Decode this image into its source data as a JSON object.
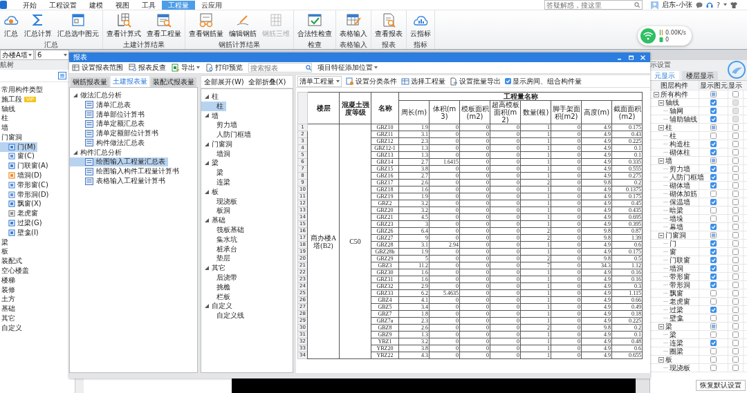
{
  "menu_bar": {
    "tabs": [
      {
        "label": "开始",
        "selected": false
      },
      {
        "label": "工程设置",
        "selected": false
      },
      {
        "label": "建模",
        "selected": false
      },
      {
        "label": "视图",
        "selected": false
      },
      {
        "label": "工具",
        "selected": false
      },
      {
        "label": "工程量",
        "selected": true
      },
      {
        "label": "云应用",
        "selected": false
      }
    ],
    "search": {
      "placeholder": "答疑解惑，搜这里"
    },
    "user": "启东-小张",
    "help": "?"
  },
  "ribbon": {
    "groups": [
      {
        "label": "汇总",
        "buttons": [
          {
            "label": "汇总",
            "disabled": false
          },
          {
            "label": "汇总计算",
            "disabled": false
          },
          {
            "label": "汇总选中图元",
            "disabled": false
          }
        ]
      },
      {
        "label": "土建计算结果",
        "buttons": [
          {
            "label": "查看计算式",
            "disabled": false
          },
          {
            "label": "查看工程量",
            "disabled": false
          }
        ]
      },
      {
        "label": "钢筋计算结果",
        "buttons": [
          {
            "label": "查看钢筋量",
            "disabled": false
          },
          {
            "label": "编辑钢筋",
            "disabled": false
          },
          {
            "label": "钢筋三维",
            "disabled": true
          }
        ]
      },
      {
        "label": "检查",
        "buttons": [
          {
            "label": "合法性检查",
            "disabled": false
          }
        ]
      },
      {
        "label": "表格输入",
        "buttons": [
          {
            "label": "表格输入",
            "disabled": false
          }
        ]
      },
      {
        "label": "报表",
        "buttons": [
          {
            "label": "查看报表",
            "disabled": false
          }
        ]
      },
      {
        "label": "指标",
        "buttons": [
          {
            "label": "云指标",
            "disabled": false
          }
        ]
      }
    ]
  },
  "network": {
    "speed": "0.00K/s",
    "count": "0"
  },
  "selectors": [
    {
      "value": "办楼A塔"
    },
    {
      "value": "6"
    }
  ],
  "nav_panel": {
    "title": "航树",
    "items": [
      {
        "label": "常用构件类型",
        "selected": false
      },
      {
        "label": "施工段",
        "selected": false,
        "badge": "VIP"
      },
      {
        "label": "轴线",
        "selected": false
      },
      {
        "label": "柱",
        "selected": false
      },
      {
        "label": "墙",
        "selected": false
      },
      {
        "label": "门窗洞",
        "selected": false,
        "children": [
          {
            "label": "门(M)",
            "selected": true
          },
          {
            "label": "窗(C)",
            "selected": false
          },
          {
            "label": "门联窗(A)",
            "selected": false
          },
          {
            "label": "墙洞(D)",
            "selected": false
          },
          {
            "label": "带形窗(C)",
            "selected": false
          },
          {
            "label": "带形洞(D)",
            "selected": false
          },
          {
            "label": "飘窗(X)",
            "selected": false
          },
          {
            "label": "老虎窗",
            "selected": false
          },
          {
            "label": "过梁(G)",
            "selected": false
          },
          {
            "label": "壁龛(I)",
            "selected": false
          }
        ]
      },
      {
        "label": "梁",
        "selected": false
      },
      {
        "label": "板",
        "selected": false
      },
      {
        "label": "装配式",
        "selected": false
      },
      {
        "label": "空心楼盖",
        "selected": false
      },
      {
        "label": "楼梯",
        "selected": false
      },
      {
        "label": "装修",
        "selected": false
      },
      {
        "label": "土方",
        "selected": false
      },
      {
        "label": "基础",
        "selected": false
      },
      {
        "label": "其它",
        "selected": false
      },
      {
        "label": "自定义",
        "selected": false
      }
    ]
  },
  "report_window": {
    "title": "报表",
    "toolbar": [
      {
        "label": "设置报表范围",
        "dropdown": false
      },
      {
        "label": "报表反查",
        "dropdown": false
      },
      {
        "label": "导出",
        "dropdown": true
      },
      {
        "label": "打印预览",
        "dropdown": false
      }
    ],
    "search": {
      "placeholder": "搜索报表"
    },
    "position_menu": {
      "label": "项目特征添加位置"
    },
    "tabs": [
      {
        "label": "钢筋报表量",
        "selected": false
      },
      {
        "label": "土建报表量",
        "selected": true
      },
      {
        "label": "装配式报表量",
        "selected": false
      }
    ],
    "report_tree": [
      {
        "label": "做法汇总分析",
        "expanded": true,
        "selected": false,
        "children": [
          {
            "label": "清单汇总表",
            "selected": false
          },
          {
            "label": "清单部位计算书",
            "selected": false
          },
          {
            "label": "清单定额汇总表",
            "selected": false
          },
          {
            "label": "清单定额部位计算书",
            "selected": false
          },
          {
            "label": "构件做法汇总表",
            "selected": false
          }
        ]
      },
      {
        "label": "构件汇总分析",
        "expanded": true,
        "selected": false,
        "children": [
          {
            "label": "绘图输入工程量汇总表",
            "selected": true
          },
          {
            "label": "绘图输入构件工程量计算书",
            "selected": false
          },
          {
            "label": "表格输入工程量计算书",
            "selected": false
          }
        ]
      }
    ],
    "expand_all": "全部展开(W)",
    "collapse_all": "全部折叠(X)",
    "component_tree": [
      {
        "label": "柱",
        "expanded": true,
        "selected": false,
        "children": [
          {
            "label": "柱",
            "selected": true
          }
        ]
      },
      {
        "label": "墙",
        "expanded": true,
        "selected": false,
        "children": [
          {
            "label": "剪力墙",
            "selected": false
          },
          {
            "label": "人防门框墙",
            "selected": false
          }
        ]
      },
      {
        "label": "门窗洞",
        "expanded": true,
        "selected": false,
        "children": [
          {
            "label": "墙洞",
            "selected": false
          }
        ]
      },
      {
        "label": "梁",
        "expanded": true,
        "selected": false,
        "children": [
          {
            "label": "梁",
            "selected": false
          },
          {
            "label": "连梁",
            "selected": false
          }
        ]
      },
      {
        "label": "板",
        "expanded": true,
        "selected": false,
        "children": [
          {
            "label": "现浇板",
            "selected": false
          },
          {
            "label": "板洞",
            "selected": false
          }
        ]
      },
      {
        "label": "基础",
        "expanded": true,
        "selected": false,
        "children": [
          {
            "label": "筏板基础",
            "selected": false
          },
          {
            "label": "集水坑",
            "selected": false
          },
          {
            "label": "桩承台",
            "selected": false
          },
          {
            "label": "垫层",
            "selected": false
          }
        ]
      },
      {
        "label": "其它",
        "expanded": true,
        "selected": false,
        "children": [
          {
            "label": "后浇带",
            "selected": false
          },
          {
            "label": "挑檐",
            "selected": false
          },
          {
            "label": "栏板",
            "selected": false
          }
        ]
      },
      {
        "label": "自定义",
        "expanded": true,
        "selected": false,
        "children": [
          {
            "label": "自定义线",
            "selected": false
          }
        ]
      }
    ],
    "quantity_type": "清单工程量",
    "table_toolbar": [
      "设置分类条件",
      "选择工程量",
      "设置批量导出"
    ],
    "show_rooms": {
      "label": "显示房间、组合构件量",
      "checked": true
    },
    "table": {
      "columns": {
        "floor": "楼层",
        "grade": "混凝土强度等级",
        "name": "名称",
        "group": "工程量名称",
        "quantities": [
          "周长(m)",
          "体积(m3)",
          "模板面积(m2)",
          "超高模板面积(m2)",
          "数量(根)",
          "脚手架面积(m2)",
          "高度(m)",
          "截面面积(m2)"
        ]
      },
      "floor": "商办楼A塔(B2)",
      "grade": "C50",
      "rows": [
        {
          "no": "1",
          "name": "GBZ10",
          "values": [
            "1.9",
            "0",
            "0",
            "0",
            "1",
            "0",
            "4.9",
            "0.175"
          ]
        },
        {
          "no": "2",
          "name": "GBZ11",
          "values": [
            "3.1",
            "0",
            "0",
            "0",
            "1",
            "0",
            "4.9",
            "0.43"
          ]
        },
        {
          "no": "3",
          "name": "GBZ12",
          "values": [
            "2.3",
            "0",
            "0",
            "0",
            "1",
            "0",
            "4.9",
            "0.225"
          ]
        },
        {
          "no": "4",
          "name": "GBZ12-1",
          "values": [
            "1.3",
            "0",
            "0",
            "0",
            "1",
            "0",
            "4.9",
            "0.1"
          ]
        },
        {
          "no": "5",
          "name": "GBZ13",
          "values": [
            "1.3",
            "0",
            "0",
            "0",
            "1",
            "0",
            "4.9",
            "0.1"
          ]
        },
        {
          "no": "6",
          "name": "GBZ14",
          "values": [
            "2.7",
            "1.6415",
            "0",
            "0",
            "1",
            "0",
            "4.9",
            "0.335"
          ]
        },
        {
          "no": "7",
          "name": "GBZ15",
          "values": [
            "3.8",
            "0",
            "0",
            "0",
            "1",
            "0",
            "4.9",
            "0.555"
          ]
        },
        {
          "no": "8",
          "name": "GBZ16",
          "values": [
            "2.7",
            "0",
            "0",
            "0",
            "1",
            "0",
            "4.9",
            "0.275"
          ]
        },
        {
          "no": "9",
          "name": "GBZ17",
          "values": [
            "2.6",
            "0",
            "0",
            "0",
            "2",
            "0",
            "9.8",
            "0.2"
          ]
        },
        {
          "no": "10",
          "name": "GBZ18",
          "values": [
            "1.6",
            "0",
            "0",
            "0",
            "1",
            "0",
            "4.9",
            "0.1375"
          ]
        },
        {
          "no": "11",
          "name": "GBZ19",
          "values": [
            "1.9",
            "0",
            "0",
            "0",
            "1",
            "0",
            "4.9",
            "0.175"
          ]
        },
        {
          "no": "12",
          "name": "GBZ2",
          "values": [
            "3.2",
            "0",
            "0",
            "0",
            "1",
            "0",
            "4.9",
            "0.45"
          ]
        },
        {
          "no": "13",
          "name": "GBZ20",
          "values": [
            "3.2",
            "0",
            "0",
            "0",
            "1",
            "0",
            "4.9",
            "0.435"
          ]
        },
        {
          "no": "14",
          "name": "GBZ21",
          "values": [
            "4.5",
            "0",
            "0",
            "0",
            "1",
            "0",
            "4.9",
            "0.695"
          ]
        },
        {
          "no": "15",
          "name": "GBZ23",
          "values": [
            "3",
            "0",
            "0",
            "0",
            "1",
            "0",
            "4.9",
            "0.395"
          ]
        },
        {
          "no": "16",
          "name": "GBZ26",
          "values": [
            "6.4",
            "0",
            "0",
            "0",
            "2",
            "0",
            "9.8",
            "0.87"
          ]
        },
        {
          "no": "17",
          "name": "GBZ27",
          "values": [
            "9",
            "0",
            "0",
            "0",
            "2",
            "0",
            "9.8",
            "1.39"
          ]
        },
        {
          "no": "18",
          "name": "GBZ28",
          "values": [
            "3.1",
            "2.94",
            "0",
            "0",
            "1",
            "0",
            "4.9",
            "0.6"
          ]
        },
        {
          "no": "19",
          "name": "GBZ28b",
          "values": [
            "1.9",
            "0",
            "0",
            "0",
            "1",
            "0",
            "4.9",
            "0.175"
          ]
        },
        {
          "no": "20",
          "name": "GBZ29",
          "values": [
            "5",
            "0",
            "0",
            "0",
            "2",
            "0",
            "9.8",
            "0.5"
          ]
        },
        {
          "no": "21",
          "name": "GBZ3",
          "values": [
            "11.2",
            "0",
            "0",
            "0",
            "7",
            "0",
            "34.3",
            "1.12"
          ]
        },
        {
          "no": "22",
          "name": "GBZ30",
          "values": [
            "1.6",
            "0",
            "0",
            "0",
            "1",
            "0",
            "4.9",
            "0.16"
          ]
        },
        {
          "no": "23",
          "name": "GBZ31",
          "values": [
            "1.6",
            "0",
            "0",
            "0",
            "1",
            "0",
            "4.9",
            "0.16"
          ]
        },
        {
          "no": "24",
          "name": "GBZ32",
          "values": [
            "2.9",
            "0",
            "0",
            "0",
            "1",
            "0",
            "4.9",
            "0.3"
          ]
        },
        {
          "no": "25",
          "name": "GBZ33",
          "values": [
            "6.2",
            "5.4635",
            "0",
            "0",
            "1",
            "0",
            "4.9",
            "1.115"
          ]
        },
        {
          "no": "26",
          "name": "GBZ4",
          "values": [
            "4.1",
            "0",
            "0",
            "0",
            "1",
            "0",
            "4.9",
            "0.66"
          ]
        },
        {
          "no": "27",
          "name": "GBZ5",
          "values": [
            "3.4",
            "0",
            "0",
            "0",
            "1",
            "0",
            "4.9",
            "0.49"
          ]
        },
        {
          "no": "28",
          "name": "GBZ7",
          "values": [
            "1.8",
            "0",
            "0",
            "0",
            "1",
            "0",
            "4.9",
            "0.18"
          ]
        },
        {
          "no": "29",
          "name": "GBZ7a",
          "values": [
            "2.3",
            "0",
            "0",
            "0",
            "1",
            "0",
            "4.9",
            "0.225"
          ]
        },
        {
          "no": "30",
          "name": "GBZ8",
          "values": [
            "2.6",
            "0",
            "0",
            "0",
            "2",
            "0",
            "9.8",
            "0.2"
          ]
        },
        {
          "no": "31",
          "name": "GBZ9",
          "values": [
            "1.3",
            "0",
            "0",
            "0",
            "1",
            "0",
            "4.9",
            "0.1"
          ]
        },
        {
          "no": "32",
          "name": "YBZ1",
          "values": [
            "3.2",
            "0",
            "0",
            "0",
            "1",
            "0",
            "4.9",
            "0.48"
          ]
        },
        {
          "no": "33",
          "name": "YBZ20",
          "values": [
            "3.8",
            "0",
            "0",
            "0",
            "1",
            "0",
            "4.9",
            "0.6"
          ]
        },
        {
          "no": "34",
          "name": "YBZ22",
          "values": [
            "4.3",
            "0",
            "0",
            "0",
            "1",
            "0",
            "4.9",
            "0.655"
          ]
        }
      ]
    }
  },
  "display_panel": {
    "title": "示设置",
    "tabs": [
      {
        "label": "元显示",
        "selected": true
      },
      {
        "label": "楼层显示",
        "selected": false
      }
    ],
    "columns": [
      "图层构件",
      "显示图元",
      "显示"
    ],
    "rows": [
      {
        "label": "所有构件",
        "expanded": true,
        "element_checked": true,
        "element_mixed": true,
        "name_shown": false,
        "name_disabled": false,
        "children": [
          {
            "label": "轴线",
            "expanded": true,
            "element_checked": true,
            "element_mixed": false,
            "name_shown": false,
            "name_disabled": true,
            "children": [
              {
                "label": "轴网",
                "element_checked": true,
                "element_mixed": false,
                "name_shown": false,
                "name_disabled": true
              },
              {
                "label": "辅助轴线",
                "element_checked": true,
                "element_mixed": false,
                "name_shown": false,
                "name_disabled": true
              }
            ]
          },
          {
            "label": "柱",
            "expanded": true,
            "element_checked": true,
            "element_mixed": true,
            "name_shown": false,
            "name_disabled": false,
            "children": [
              {
                "label": "柱",
                "element_checked": false,
                "element_mixed": false,
                "name_shown": false,
                "name_disabled": false
              },
              {
                "label": "构造柱",
                "element_checked": true,
                "element_mixed": false,
                "name_shown": false,
                "name_disabled": false
              },
              {
                "label": "砌体柱",
                "element_checked": true,
                "element_mixed": false,
                "name_shown": false,
                "name_disabled": false
              }
            ]
          },
          {
            "label": "墙",
            "expanded": true,
            "element_checked": true,
            "element_mixed": true,
            "name_shown": false,
            "name_disabled": false,
            "children": [
              {
                "label": "剪力墙",
                "element_checked": true,
                "element_mixed": false,
                "name_shown": false,
                "name_disabled": false
              },
              {
                "label": "人防门框墙",
                "element_checked": true,
                "element_mixed": false,
                "name_shown": false,
                "name_disabled": false
              },
              {
                "label": "砌体墙",
                "element_checked": true,
                "element_mixed": false,
                "name_shown": false,
                "name_disabled": false
              },
              {
                "label": "砌体加筋",
                "element_checked": false,
                "element_mixed": false,
                "name_shown": false,
                "name_disabled": false
              },
              {
                "label": "保温墙",
                "element_checked": true,
                "element_mixed": false,
                "name_shown": false,
                "name_disabled": false
              },
              {
                "label": "暗梁",
                "element_checked": false,
                "element_mixed": false,
                "name_shown": false,
                "name_disabled": false
              },
              {
                "label": "墙垛",
                "element_checked": false,
                "element_mixed": false,
                "name_shown": false,
                "name_disabled": false
              },
              {
                "label": "幕墙",
                "element_checked": true,
                "element_mixed": false,
                "name_shown": false,
                "name_disabled": false
              }
            ]
          },
          {
            "label": "门窗洞",
            "expanded": true,
            "element_checked": true,
            "element_mixed": true,
            "name_shown": false,
            "name_disabled": false,
            "children": [
              {
                "label": "门",
                "element_checked": true,
                "element_mixed": false,
                "name_shown": false,
                "name_disabled": false
              },
              {
                "label": "窗",
                "element_checked": true,
                "element_mixed": false,
                "name_shown": false,
                "name_disabled": false
              },
              {
                "label": "门联窗",
                "element_checked": true,
                "element_mixed": false,
                "name_shown": false,
                "name_disabled": false
              },
              {
                "label": "墙洞",
                "element_checked": true,
                "element_mixed": false,
                "name_shown": false,
                "name_disabled": false
              },
              {
                "label": "带形窗",
                "element_checked": true,
                "element_mixed": false,
                "name_shown": false,
                "name_disabled": false
              },
              {
                "label": "带形洞",
                "element_checked": true,
                "element_mixed": false,
                "name_shown": false,
                "name_disabled": false
              },
              {
                "label": "飘窗",
                "element_checked": false,
                "element_mixed": false,
                "name_shown": false,
                "name_disabled": false
              },
              {
                "label": "老虎窗",
                "element_checked": false,
                "element_mixed": false,
                "name_shown": false,
                "name_disabled": false
              },
              {
                "label": "过梁",
                "element_checked": true,
                "element_mixed": false,
                "name_shown": false,
                "name_disabled": false
              },
              {
                "label": "壁龛",
                "element_checked": false,
                "element_mixed": false,
                "name_shown": false,
                "name_disabled": false
              }
            ]
          },
          {
            "label": "梁",
            "expanded": true,
            "element_checked": true,
            "element_mixed": true,
            "name_shown": false,
            "name_disabled": false,
            "children": [
              {
                "label": "梁",
                "element_checked": false,
                "element_mixed": false,
                "name_shown": false,
                "name_disabled": false
              },
              {
                "label": "连梁",
                "element_checked": true,
                "element_mixed": false,
                "name_shown": false,
                "name_disabled": false
              },
              {
                "label": "圈梁",
                "element_checked": false,
                "element_mixed": false,
                "name_shown": false,
                "name_disabled": false
              }
            ]
          },
          {
            "label": "板",
            "expanded": true,
            "element_checked": false,
            "element_mixed": false,
            "name_shown": false,
            "name_disabled": false,
            "children": [
              {
                "label": "现浇板",
                "element_checked": false,
                "element_mixed": false,
                "name_shown": false,
                "name_disabled": false
              }
            ]
          }
        ]
      }
    ],
    "reset_button": "恢复默认设置"
  }
}
